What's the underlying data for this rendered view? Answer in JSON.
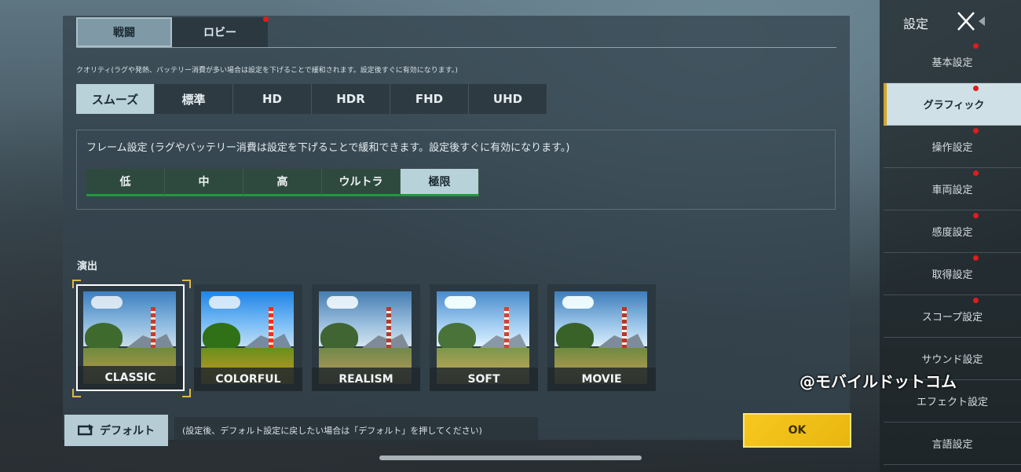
{
  "tabs": [
    {
      "label": "戦闘",
      "active": true,
      "badge": false
    },
    {
      "label": "ロビー",
      "active": false,
      "badge": true
    }
  ],
  "quality": {
    "label": "クオリティ(ラグや発熱、バッテリー消費が多い場合は設定を下げることで緩和されます。設定後すぐに有効になります。)",
    "options": [
      "スムーズ",
      "標準",
      "HD",
      "HDR",
      "FHD",
      "UHD"
    ],
    "selected_index": 0
  },
  "frame": {
    "label": "フレーム設定 (ラグやバッテリー消費は設定を下げることで緩和できます。設定後すぐに有効になります。)",
    "options": [
      "低",
      "中",
      "高",
      "ウルトラ",
      "極限"
    ],
    "selected_index": 4
  },
  "effects": {
    "label": "演出",
    "options": [
      "CLASSIC",
      "COLORFUL",
      "REALISM",
      "SOFT",
      "MOVIE"
    ],
    "selected_index": 0
  },
  "footer": {
    "default_label": "デフォルト",
    "default_note": "(設定後、デフォルト設定に戻したい場合は「デフォルト」を押してください)",
    "ok_label": "OK"
  },
  "sidebar": {
    "title": "設定",
    "items": [
      {
        "label": "基本設定",
        "active": false,
        "badge": true
      },
      {
        "label": "グラフィック",
        "active": true,
        "badge": true
      },
      {
        "label": "操作設定",
        "active": false,
        "badge": true
      },
      {
        "label": "車両設定",
        "active": false,
        "badge": true
      },
      {
        "label": "感度設定",
        "active": false,
        "badge": true
      },
      {
        "label": "取得設定",
        "active": false,
        "badge": true
      },
      {
        "label": "スコープ設定",
        "active": false,
        "badge": true
      },
      {
        "label": "サウンド設定",
        "active": false,
        "badge": false
      },
      {
        "label": "エフェクト設定",
        "active": false,
        "badge": false
      },
      {
        "label": "言語設定",
        "active": false,
        "badge": false
      }
    ]
  },
  "watermark": "@モバイルドットコム",
  "colors": {
    "accent": "#f6c820",
    "badge": "#e21b1b",
    "selected": "#b9d2da"
  }
}
